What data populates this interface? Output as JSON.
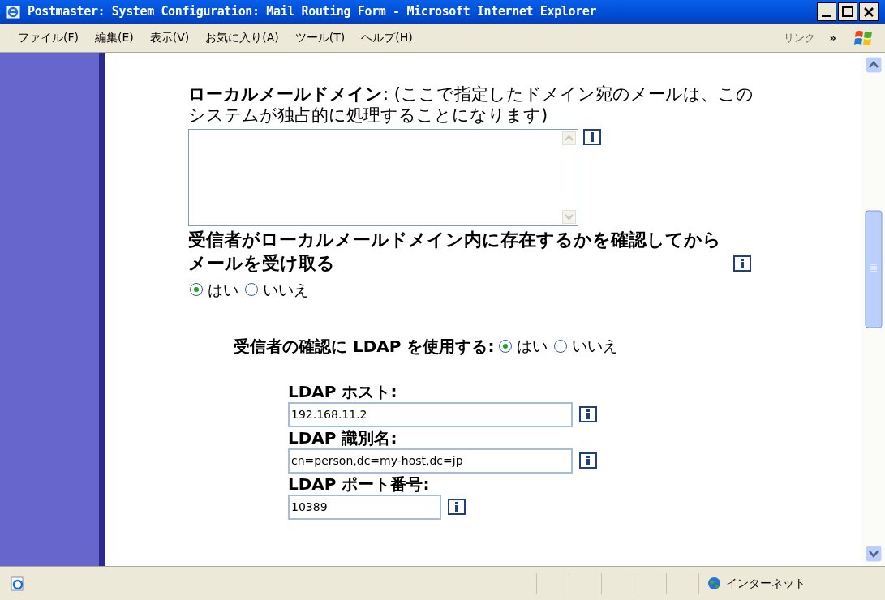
{
  "window": {
    "title": "Postmaster: System Configuration: Mail Routing Form - Microsoft Internet Explorer"
  },
  "menu": [
    "ファイル(F)",
    "編集(E)",
    "表示(V)",
    "お気に入り(A)",
    "ツール(T)",
    "ヘルプ(H)"
  ],
  "links": {
    "label": "リンク",
    "chevron": "»"
  },
  "form": [
    {
      "kind": "textarea",
      "label": "**ローカルメールドメイン**: (ここで指定したドメイン宛のメールは、このシステムが独占的に処理することになります)"
    },
    {
      "kind": "radio",
      "label": "受信者がローカルメールドメイン内に存在するかを確認してからメールを受け取る",
      "options": [
        {
          "label": "はい",
          "selected": true
        },
        {
          "label": "いいえ",
          "selected": false
        }
      ]
    },
    {
      "kind": "inline_radio",
      "label": "受信者の確認に LDAP を使用する:",
      "options": [
        {
          "label": "はい",
          "selected": true
        },
        {
          "label": "いいえ",
          "selected": false
        }
      ]
    },
    {
      "kind": "text",
      "label": "LDAP ホスト:",
      "value": "192.168.11.2"
    },
    {
      "kind": "text",
      "label": "LDAP 識別名:",
      "value": "cn=person,dc=my-host,dc=jp"
    },
    {
      "kind": "short_text",
      "label": "LDAP ポート番号:",
      "value": "10389"
    }
  ],
  "status_bar": {
    "zone": "インターネット"
  }
}
